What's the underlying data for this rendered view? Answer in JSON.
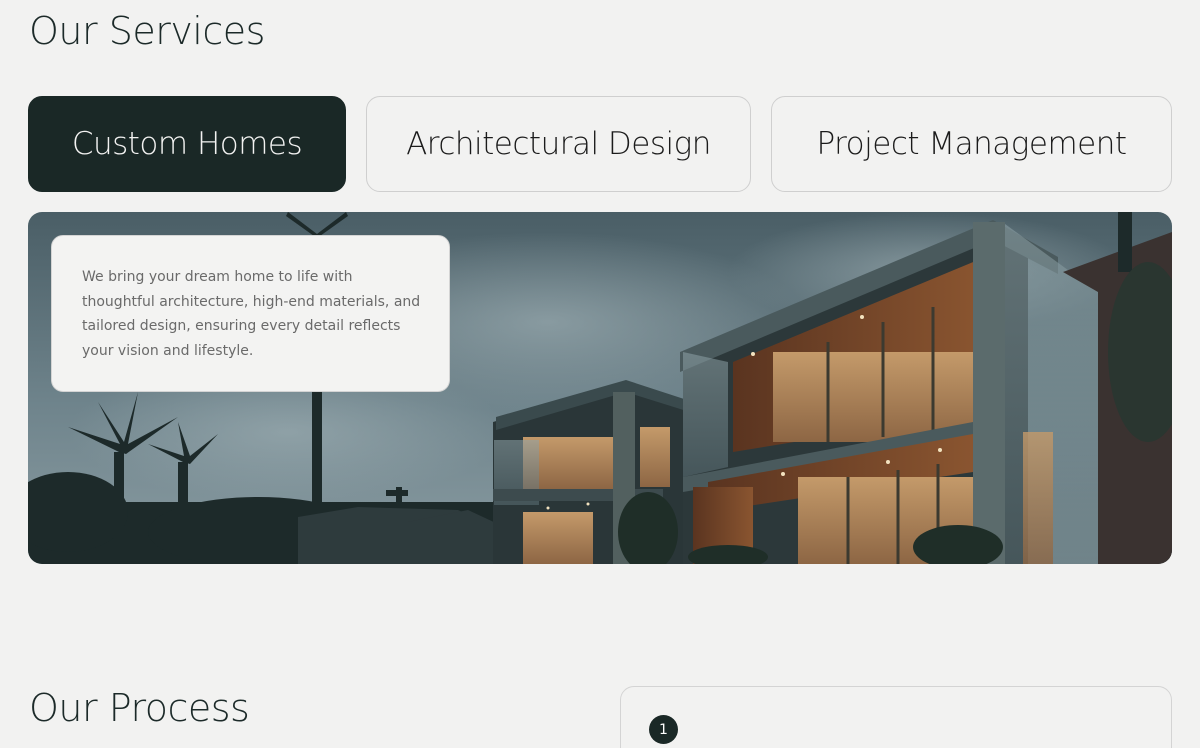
{
  "services": {
    "title": "Our Services",
    "tabs": [
      {
        "label": "Custom Homes",
        "active": true
      },
      {
        "label": "Architectural Design",
        "active": false
      },
      {
        "label": "Project Management",
        "active": false
      }
    ],
    "description": "We bring your dream home to life with thoughtful architecture, high-end materials, and tailored design, ensuring every detail reflects your vision and lifestyle."
  },
  "process": {
    "title": "Our Process",
    "steps": [
      {
        "number": "1"
      }
    ]
  },
  "colors": {
    "background": "#f2f2f1",
    "primary_dark": "#1a2826",
    "text": "#1c2a29",
    "muted_text": "#6a6a6a",
    "border": "#cfcfcf"
  }
}
